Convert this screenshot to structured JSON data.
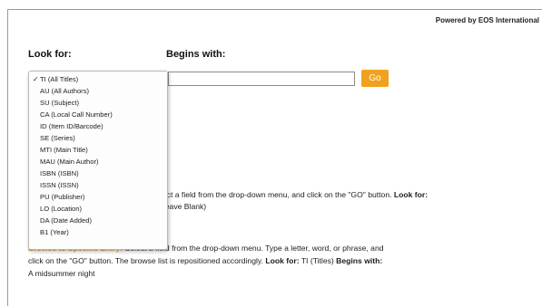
{
  "header": {
    "powered_by": "Powered by EOS International"
  },
  "search": {
    "look_for_label": "Look for:",
    "begins_with_label": "Begins with:",
    "begins_with_value": "",
    "go_label": "Go"
  },
  "dropdown": {
    "selected_index": 0,
    "options": [
      "TI (All Titles)",
      "AU (All Authors)",
      "SU (Subject)",
      "CA (Local Call Number)",
      "ID (Item ID/Barcode)",
      "SE (Series)",
      "MTI (Main Title)",
      "MAU (Main Author)",
      "ISBN (ISBN)",
      "ISSN (ISSN)",
      "PU (Publisher)",
      "LO (Location)",
      "DA (Date Added)",
      "B1 (Year)"
    ]
  },
  "instructions": {
    "line1_start": "lect a field from the drop-down menu, and click on the \"GO\" button.",
    "line1_bold": "Look for:",
    "line2": "Leave Blank)",
    "browse_title": "Browse to Specific Entry:",
    "browse_line1": "Select a field from the drop-down menu. Type a letter, word, or phrase, and",
    "browse_line2_start": "click on the \"GO\" button. The browse list is repositioned accordingly.",
    "browse_line2_bold_look": "Look for:",
    "browse_line2_value": "TI (Titles)",
    "browse_line2_bold_begins": "Begins with:",
    "browse_line3": "A midsummer night"
  }
}
